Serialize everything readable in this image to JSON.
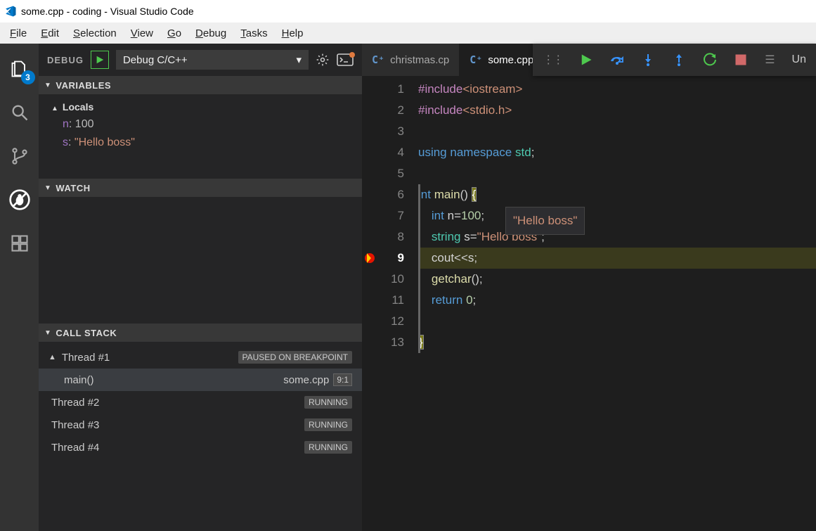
{
  "titlebar": {
    "text": "some.cpp - coding - Visual Studio Code"
  },
  "menubar": [
    "File",
    "Edit",
    "Selection",
    "View",
    "Go",
    "Debug",
    "Tasks",
    "Help"
  ],
  "activitybar": {
    "explorer_badge": "3"
  },
  "debug": {
    "label": "DEBUG",
    "config": "Debug C/C++",
    "sections": {
      "variables": "VARIABLES",
      "watch": "WATCH",
      "callstack": "CALL STACK"
    },
    "locals_label": "Locals",
    "vars": [
      {
        "name": "n",
        "value": "100",
        "kind": "num"
      },
      {
        "name": "s",
        "value": "\"Hello boss\"",
        "kind": "str"
      }
    ],
    "callstack": {
      "thread1": "Thread #1",
      "thread1_state": "PAUSED ON BREAKPOINT",
      "frame_fn": "main()",
      "frame_file": "some.cpp",
      "frame_pos": "9:1",
      "others": [
        {
          "name": "Thread #2",
          "state": "RUNNING"
        },
        {
          "name": "Thread #3",
          "state": "RUNNING"
        },
        {
          "name": "Thread #4",
          "state": "RUNNING"
        }
      ]
    }
  },
  "tabs": [
    {
      "label": "christmas.cp",
      "active": false
    },
    {
      "label": "some.cpp",
      "active": true
    }
  ],
  "debug_toolbar_trunc": "Un",
  "hover": {
    "text": "\"Hello boss\""
  },
  "code": {
    "lines": [
      "#include<iostream>",
      "#include<stdio.h>",
      "",
      "using namespace std;",
      "",
      "int main() {",
      "    int n=100;",
      "    string s=\"Hello boss\";",
      "    cout<<s;",
      "    getchar();",
      "    return 0;",
      "",
      "}"
    ],
    "exec_line": 9,
    "breakpoint_line": 9
  }
}
